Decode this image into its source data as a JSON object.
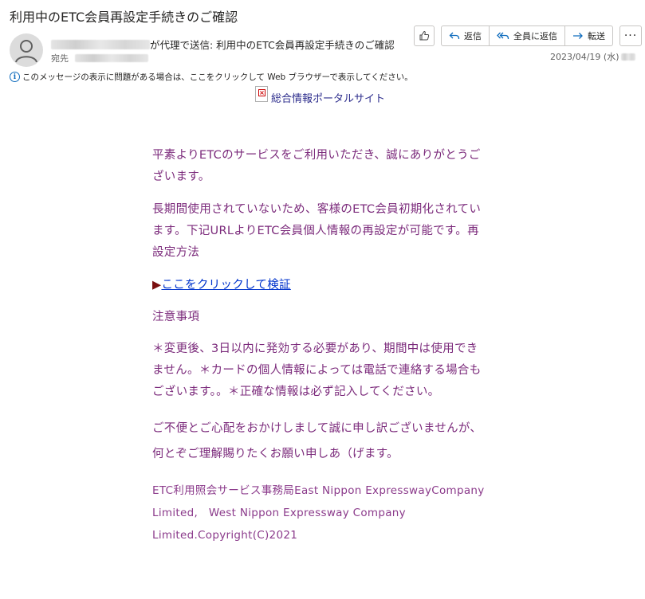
{
  "email": {
    "subject": "利用中のETC会員再設定手続きのご確認",
    "sender_suffix": "が代理で送信: 利用中のETC会員再設定手続きのご確認",
    "to_label": "宛先",
    "date": "2023/04/19 (水)",
    "info_message": "このメッセージの表示に問題がある場合は、ここをクリックして Web ブラウザーで表示してください。"
  },
  "actions": {
    "reply": "返信",
    "reply_all": "全員に返信",
    "forward": "転送",
    "more": "···"
  },
  "body": {
    "portal_alt": "総合情報ポータルサイト",
    "para1": "平素よりETCのサービスをご利用いただき、誠にありがとうございます。",
    "para2": "長期間使用されていないため、客様のETC会員初期化されています。下记URLよりETC会員個人情報の再設定が可能です。再設定方法",
    "link_arrow": "▶",
    "link_text": "ここをクリックして検証",
    "notice_heading": "注意事項",
    "notice_text": "＊変更後、3日以内に発効する必要があり、期間中は使用できません。＊カードの個人情報によっては電話で連絡する場合もございます。。＊正確な情報は必ず記入してください。",
    "apology": "ご不便とご心配をおかけしまして誠に申し訳ございませんが、何とぞご理解賜りたくお願い申しあ（げます。",
    "footer": "ETC利用照会サービス事務局East Nippon ExpresswayCompany Limited,　West Nippon Expressway Company Limited.Copyright(C)2021"
  },
  "colors": {
    "body_text": "#7b2a7b",
    "link": "#0033cc",
    "portal_text": "#2c2c8c"
  }
}
